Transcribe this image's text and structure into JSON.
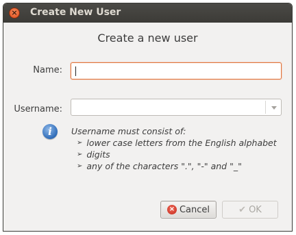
{
  "window": {
    "title": "Create New User",
    "close_icon": "close-icon"
  },
  "heading": "Create a new user",
  "form": {
    "name_label": "Name:",
    "name_value": "",
    "username_label": "Username:",
    "username_value": ""
  },
  "hint": {
    "icon": "info-icon",
    "intro": "Username must consist of:",
    "items": [
      "lower case letters from the English alphabet",
      "digits",
      "any of the characters \".\", \"-\" and \"_\""
    ],
    "bullet": "➢"
  },
  "buttons": {
    "cancel_label": "Cancel",
    "ok_label": "OK"
  },
  "colors": {
    "focus_border": "#e0773d",
    "titlebar": "#3c3b37",
    "info_blue": "#2f6cb8"
  }
}
